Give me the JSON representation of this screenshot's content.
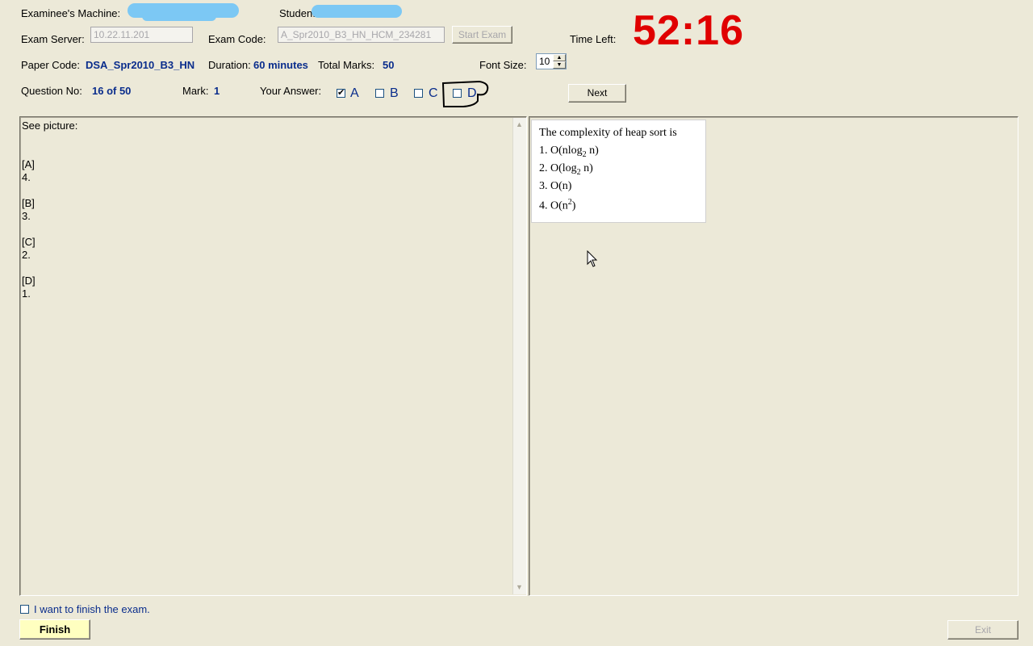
{
  "header": {
    "machine_label": "Examinee's Machine:",
    "machine_value": "",
    "student_label": "Student",
    "student_value": "",
    "server_label": "Exam Server:",
    "server_value": "10.22.11.201",
    "exam_code_label": "Exam Code:",
    "exam_code_value": "A_Spr2010_B3_HN_HCM_234281",
    "start_exam_label": "Start Exam",
    "time_left_label": "Time Left:",
    "time_left_value": "52:16",
    "paper_code_label": "Paper Code:",
    "paper_code_value": "DSA_Spr2010_B3_HN",
    "duration_label": "Duration:",
    "duration_value": "60 minutes",
    "total_marks_label": "Total Marks:",
    "total_marks_value": "50",
    "font_size_label": "Font Size:",
    "font_size_value": "10",
    "question_no_label": "Question No:",
    "question_no_value": "16 of 50",
    "mark_label": "Mark:",
    "mark_value": "1",
    "your_answer_label": "Your Answer:",
    "options": [
      {
        "letter": "A",
        "checked": true
      },
      {
        "letter": "B",
        "checked": false
      },
      {
        "letter": "C",
        "checked": false
      },
      {
        "letter": "D",
        "checked": false
      }
    ],
    "next_label": "Next"
  },
  "answers_panel": {
    "intro": "See picture:",
    "items": [
      {
        "tag": "[A]",
        "text": "4."
      },
      {
        "tag": "[B]",
        "text": "3."
      },
      {
        "tag": "[C]",
        "text": "2."
      },
      {
        "tag": "[D]",
        "text": "1."
      }
    ]
  },
  "question_image": {
    "line0": "The complexity of  heap sort is",
    "line1_prefix": "1. O(nlog",
    "line1_sub": "2",
    "line1_suffix": " n)",
    "line2_prefix": "2. O(log",
    "line2_sub": "2",
    "line2_suffix": " n)",
    "line3": "3. O(n)",
    "line4_prefix": "4. O(n",
    "line4_sup": "2",
    "line4_suffix": ")"
  },
  "footer": {
    "finish_check_label": "I want to finish the exam.",
    "finish_label": "Finish",
    "exit_label": "Exit"
  },
  "colors": {
    "background": "#ece9d8",
    "timer": "#e00000",
    "value_blue": "#0a2d8c",
    "finish_button": "#ffffc0",
    "redaction": "#7cc8f4"
  }
}
